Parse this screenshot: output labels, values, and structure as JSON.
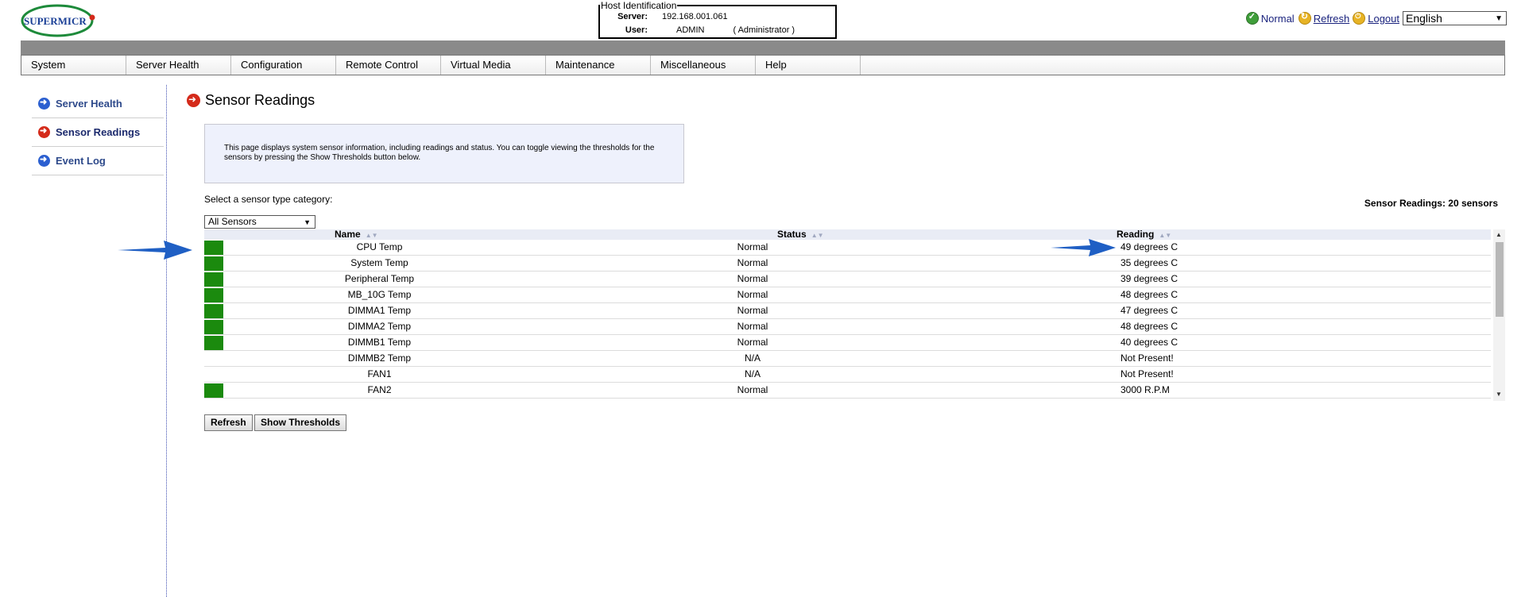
{
  "logo": {
    "text": "SUPERMICR"
  },
  "host": {
    "legend": "Host Identification",
    "server_label": "Server:",
    "server_value": "192.168.001.061",
    "user_label": "User:",
    "user_value": "ADMIN",
    "user_role": "( Administrator )"
  },
  "status": {
    "normal_text": "Normal",
    "refresh_link": "Refresh",
    "logout_link": "Logout",
    "language": "English"
  },
  "nav": [
    "System",
    "Server Health",
    "Configuration",
    "Remote Control",
    "Virtual Media",
    "Maintenance",
    "Miscellaneous",
    "Help"
  ],
  "sidebar": [
    {
      "label": "Server Health",
      "icon": "arrow-right-blue-icon"
    },
    {
      "label": "Sensor Readings",
      "icon": "arrow-right-red-icon"
    },
    {
      "label": "Event Log",
      "icon": "arrow-right-blue-icon"
    }
  ],
  "main": {
    "title": "Sensor Readings",
    "info_text": "This page displays system sensor information, including readings and status. You can toggle viewing the thresholds for the sensors by pressing the Show Thresholds button below.",
    "select_label": "Select a sensor type category:",
    "select_value": "All Sensors",
    "sensor_count": "Sensor Readings: 20 sensors",
    "refresh_button": "Refresh",
    "thresholds_button": "Show Thresholds"
  },
  "table": {
    "headers": {
      "name": "Name",
      "status": "Status",
      "reading": "Reading"
    },
    "rows": [
      {
        "name": "CPU Temp",
        "status": "Normal",
        "reading": "49 degrees C",
        "indicator": "green"
      },
      {
        "name": "System Temp",
        "status": "Normal",
        "reading": "35 degrees C",
        "indicator": "green"
      },
      {
        "name": "Peripheral Temp",
        "status": "Normal",
        "reading": "39 degrees C",
        "indicator": "green"
      },
      {
        "name": "MB_10G Temp",
        "status": "Normal",
        "reading": "48 degrees C",
        "indicator": "green"
      },
      {
        "name": "DIMMA1 Temp",
        "status": "Normal",
        "reading": "47 degrees C",
        "indicator": "green"
      },
      {
        "name": "DIMMA2 Temp",
        "status": "Normal",
        "reading": "48 degrees C",
        "indicator": "green"
      },
      {
        "name": "DIMMB1 Temp",
        "status": "Normal",
        "reading": "40 degrees C",
        "indicator": "green"
      },
      {
        "name": "DIMMB2 Temp",
        "status": "N/A",
        "reading": "Not Present!",
        "indicator": "none"
      },
      {
        "name": "FAN1",
        "status": "N/A",
        "reading": "Not Present!",
        "indicator": "none"
      },
      {
        "name": "FAN2",
        "status": "Normal",
        "reading": "3000 R.P.M",
        "indicator": "green"
      }
    ]
  },
  "colors": {
    "indicator_green": "#1b8a0e",
    "arrow_blue": "#1f5fc4",
    "nav_band": "#8a8a8a"
  }
}
